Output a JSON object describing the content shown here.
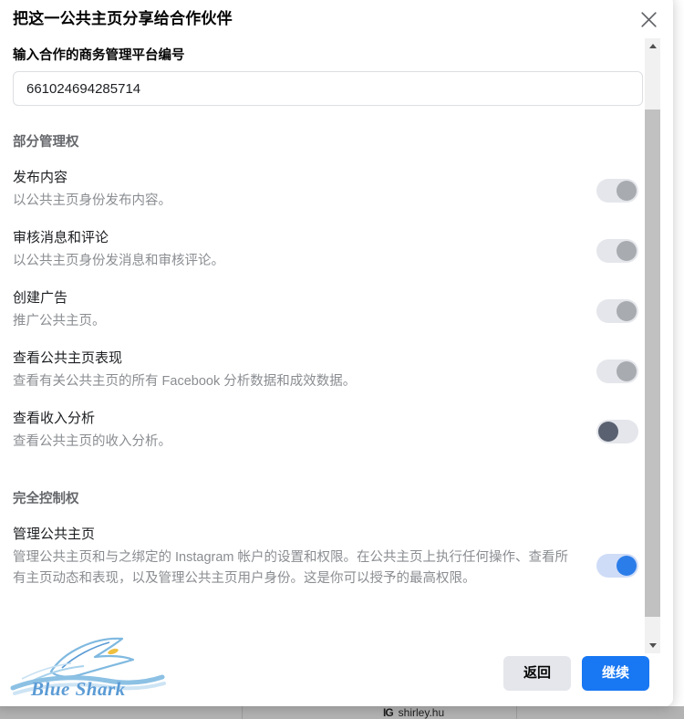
{
  "dialog": {
    "title": "把这一公共主页分享给合作伙伴",
    "close_icon": "close-icon",
    "field": {
      "label": "输入合作的商务管理平台编号",
      "value": "661024694285714",
      "placeholder": ""
    },
    "sections": [
      {
        "title": "部分管理权",
        "permissions": [
          {
            "name": "发布内容",
            "description": "以公共主页身份发布内容。",
            "toggle_state": "disabled-on"
          },
          {
            "name": "审核消息和评论",
            "description": "以公共主页身份发消息和审核评论。",
            "toggle_state": "disabled-on"
          },
          {
            "name": "创建广告",
            "description": "推广公共主页。",
            "toggle_state": "disabled-on"
          },
          {
            "name": "查看公共主页表现",
            "description": "查看有关公共主页的所有 Facebook 分析数据和成效数据。",
            "toggle_state": "disabled-on"
          },
          {
            "name": "查看收入分析",
            "description": "查看公共主页的收入分析。",
            "toggle_state": "disabled-off"
          }
        ]
      },
      {
        "title": "完全控制权",
        "permissions": [
          {
            "name": "管理公共主页",
            "description": "管理公共主页和与之绑定的 Instagram 帐户的设置和权限。在公共主页上执行任何操作、查看所有主页动态和表现，以及管理公共主页用户身份。这是你可以授予的最高权限。",
            "toggle_state": "on"
          }
        ]
      }
    ],
    "footer": {
      "back_label": "返回",
      "continue_label": "继续",
      "logo_text": "Blue Shark",
      "logo_icon": "shark-wave-logo-icon"
    }
  },
  "scrollbar": {
    "up_arrow_icon": "scroll-up-arrow-icon",
    "down_arrow_icon": "scroll-down-arrow-icon"
  },
  "background": {
    "username": "shirley.hu",
    "app_icon": "instagram-wordmark-icon"
  },
  "colors": {
    "primary": "#1877f2",
    "toggle_on_track": "#cfdcf7",
    "toggle_on_knob": "#2b7de9",
    "toggle_off_knob": "#5a6271",
    "toggle_disabled_track": "#e4e6eb",
    "secondary_button": "#e4e6eb",
    "text_primary": "#1c1e21",
    "text_muted": "#8a8d91",
    "logo_blue": "#5b9bd5",
    "scrollbar_thumb": "#c1c1c1"
  }
}
